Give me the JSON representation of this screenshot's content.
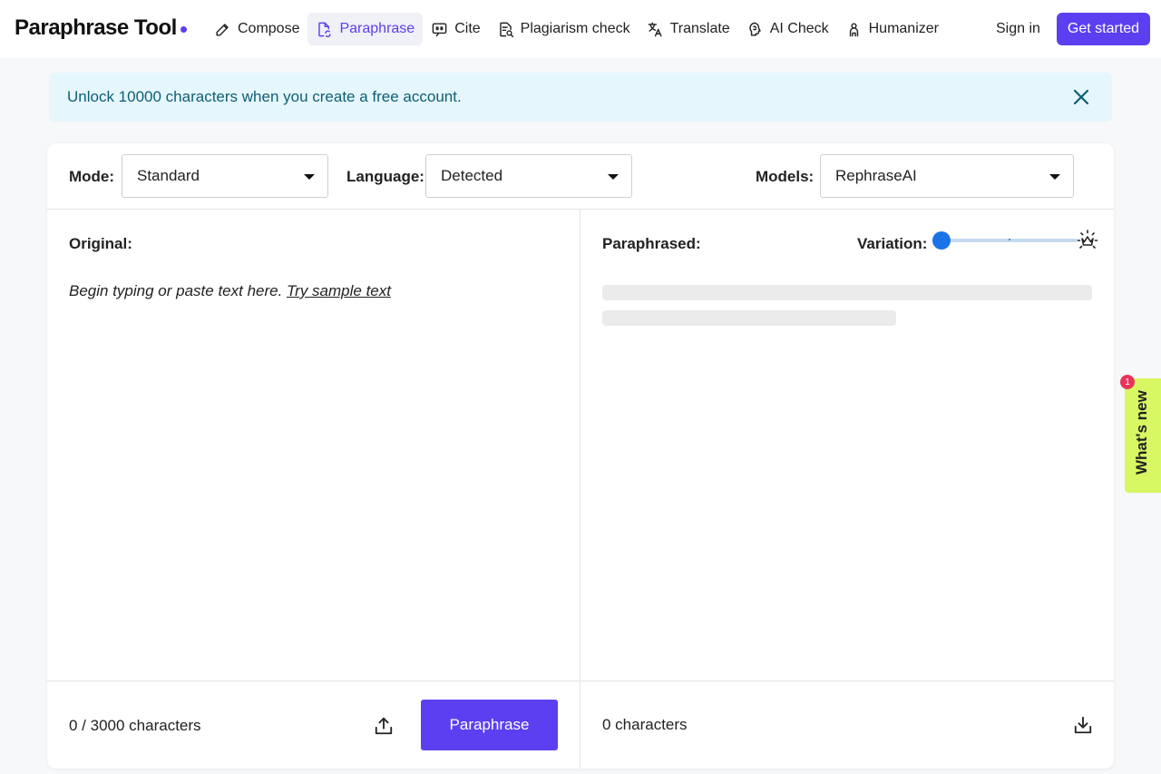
{
  "header": {
    "brand": "Paraphrase Tool",
    "nav": [
      {
        "label": "Compose",
        "icon": "pencil-icon"
      },
      {
        "label": "Paraphrase",
        "icon": "doc-cycle-icon",
        "active": true
      },
      {
        "label": "Cite",
        "icon": "quote-icon"
      },
      {
        "label": "Plagiarism check",
        "icon": "doc-search-icon"
      },
      {
        "label": "Translate",
        "icon": "translate-icon"
      },
      {
        "label": "AI Check",
        "icon": "brain-icon"
      },
      {
        "label": "Humanizer",
        "icon": "person-icon"
      }
    ],
    "signin": "Sign in",
    "get_started": "Get started"
  },
  "banner": {
    "text": "Unlock 10000 characters when you create a free account."
  },
  "toolbar": {
    "mode_label": "Mode:",
    "mode_value": "Standard",
    "language_label": "Language:",
    "language_value": "Detected",
    "models_label": "Models:",
    "models_value": "RephraseAI"
  },
  "original": {
    "label": "Original:",
    "placeholder": "Begin typing or paste text here.",
    "sample_link": "Try sample text",
    "count": "0 / 3000 characters",
    "button": "Paraphrase"
  },
  "paraphrased": {
    "label": "Paraphrased:",
    "variation_label": "Variation:",
    "variation_level": 0,
    "count": "0 characters"
  },
  "whats_new": {
    "label": "What's new",
    "badge": "1"
  },
  "colors": {
    "accent": "#5b3ff0",
    "banner_bg": "#e6f6fd",
    "banner_text": "#0d5f73",
    "slider": "#1a73e8",
    "whats_new_bg": "#d7f763",
    "badge": "#e8345a"
  }
}
